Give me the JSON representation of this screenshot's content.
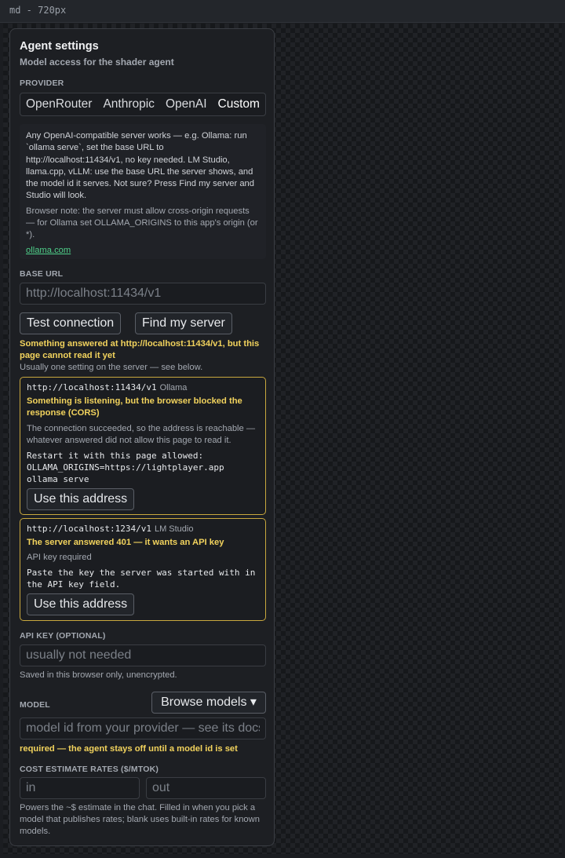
{
  "topbar": {
    "label": "md - 720px"
  },
  "panel": {
    "title": "Agent settings",
    "subtitle": "Model access for the shader agent"
  },
  "provider": {
    "label": "PROVIDER",
    "tabs": [
      "OpenRouter",
      "Anthropic",
      "OpenAI",
      "Custom"
    ],
    "selected": "Custom"
  },
  "info": {
    "body": "Any OpenAI-compatible server works — e.g. Ollama: run `ollama serve`, set the base URL to http://localhost:11434/v1, no key needed. LM Studio, llama.cpp, vLLM: use the base URL the server shows, and the model id it serves. Not sure? Press Find my server and Studio will look.",
    "note": "Browser note: the server must allow cross-origin requests — for Ollama set OLLAMA_ORIGINS to this app's origin (or *).",
    "link": "ollama.com"
  },
  "base_url": {
    "label": "BASE URL",
    "placeholder": "http://localhost:11434/v1",
    "test_button": "Test connection",
    "find_button": "Find my server",
    "status_title": "Something answered at http://localhost:11434/v1, but this page cannot read it yet",
    "status_hint": "Usually one setting on the server — see below."
  },
  "servers": [
    {
      "address": "http://localhost:11434/v1",
      "name": "Ollama",
      "status": "Something is listening, but the browser blocked the response (CORS)",
      "detail": "The connection succeeded, so the address is reachable — whatever answered did not allow this page to read it.",
      "instructions": "Restart it with this page allowed:\nOLLAMA_ORIGINS=https://lightplayer.app\nollama serve",
      "button": "Use this address"
    },
    {
      "address": "http://localhost:1234/v1",
      "name": "LM Studio",
      "status": "The server answered 401 — it wants an API key",
      "detail": "API key required",
      "instructions": "Paste the key the server was started with in\nthe API key field.",
      "button": "Use this address"
    }
  ],
  "api_key": {
    "label": "API KEY (OPTIONAL)",
    "placeholder": "usually not needed",
    "hint": "Saved in this browser only, unencrypted."
  },
  "model": {
    "label": "MODEL",
    "browse_button": "Browse models ▾",
    "placeholder": "model id from your provider — see its docs",
    "warning": "required — the agent stays off until a model id is set"
  },
  "cost": {
    "label": "COST ESTIMATE RATES ($/MTOK)",
    "in_placeholder": "in",
    "out_placeholder": "out",
    "hint": "Powers the ~$ estimate in the chat. Filled in when you pick a model that publishes rates; blank uses built-in rates for known models."
  },
  "colors": {
    "warning": "#f2d35d",
    "card_border": "#c9a83e",
    "link": "#4fd08a"
  }
}
